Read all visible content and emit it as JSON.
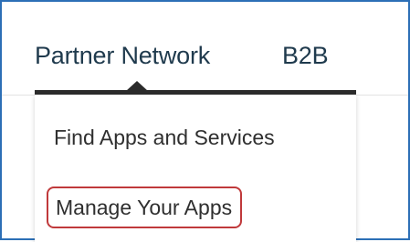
{
  "nav": {
    "tabs": [
      {
        "label": "Partner Network",
        "active": true
      },
      {
        "label": "B2B",
        "active": false
      }
    ]
  },
  "dropdown": {
    "items": [
      {
        "label": "Find Apps and Services",
        "highlighted": false
      },
      {
        "label": "Manage Your Apps",
        "highlighted": true
      }
    ]
  },
  "colors": {
    "frame_border": "#2c6fb6",
    "tab_text": "#1f3a4d",
    "active_underline": "#2b2b2b",
    "menu_text": "#2f2f2f",
    "highlight_border": "#c0393b"
  }
}
